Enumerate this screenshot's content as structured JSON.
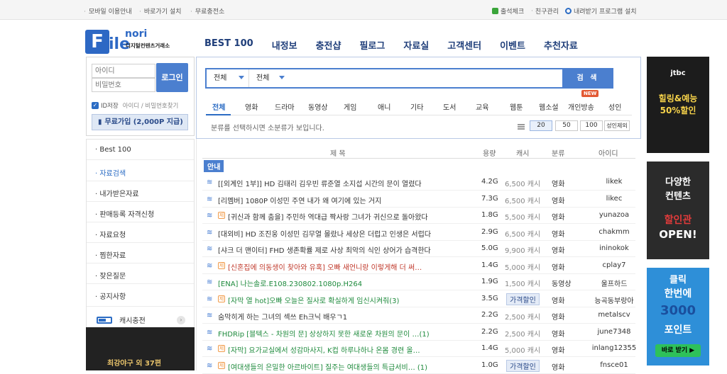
{
  "topbar": {
    "left": [
      "모바일 이용안내",
      "바로가기 설치",
      "무료충전소"
    ],
    "right": [
      "출석체크",
      "친구관리",
      "내려받기 프로그램 설치"
    ]
  },
  "logo": {
    "big": "F",
    "ile": "ile",
    "nori": "nori",
    "sub": "디지털컨텐츠거래소"
  },
  "gnb": [
    "BEST 100",
    "내정보",
    "충전샵",
    "필로그",
    "자료실",
    "고객센터",
    "이벤트",
    "추천자료"
  ],
  "login": {
    "id_placeholder": "아이디",
    "pw_placeholder": "비밀번호",
    "button": "로그인",
    "save_id": "ID저장",
    "find": "아이디 / 비밀번호찾기",
    "join": "무료가입 (2,000P 지급)"
  },
  "left_menu": [
    "Best 100",
    "자료검색",
    "내가받은자료",
    "판매등록 자격신청",
    "자료요청",
    "찜한자료",
    "잦은질문",
    "공지사항"
  ],
  "cash_label": "캐시충전",
  "left_banner_text": "최강야구 외 37편",
  "search": {
    "select1": "전체",
    "select2": "전체",
    "button": "검 색",
    "categories": [
      "전체",
      "영화",
      "드라마",
      "동영상",
      "게임",
      "애니",
      "기타",
      "도서",
      "교육",
      "웹툰",
      "웹소설",
      "개인방송",
      "성인"
    ],
    "new_badge": "NEW",
    "hint": "분류를 선택하시면 소분류가 보입니다.",
    "page_sizes": [
      "20",
      "50",
      "100"
    ],
    "adult_exclude": "성인제외"
  },
  "table": {
    "headers": {
      "title": "제 목",
      "size": "용량",
      "cash": "캐시",
      "kind": "분류",
      "id": "아이디"
    },
    "notice": "안내",
    "rows": [
      {
        "title": "[[외계인 1부]] HD 김태리 김우빈 류준열 소지섭 시간의 문이 열렸다",
        "size": "4.2G",
        "price": "6,500 캐시",
        "kind": "영화",
        "uid": "likek",
        "color": "#333333",
        "jj": false,
        "tag": false
      },
      {
        "title": "[리멤버] 1080P 이성민 주연 내가 왜 여기에 있는 거지",
        "size": "7.3G",
        "price": "6,500 캐시",
        "kind": "영화",
        "uid": "likec",
        "color": "#333333",
        "jj": false,
        "tag": false
      },
      {
        "title": "[귀신과 함께 춤을] 주민하 역대급 짝사랑 그녀가 귀신으로 돌아왔다",
        "size": "1.8G",
        "price": "5,500 캐시",
        "kind": "영화",
        "uid": "yunazoa",
        "color": "#333333",
        "jj": true,
        "tag": false
      },
      {
        "title": "[대외비] HD 조진웅 이성민 김무열 몰랐나 세상은 더럽고 인생은 서럽다",
        "size": "2.9G",
        "price": "6,500 캐시",
        "kind": "영화",
        "uid": "chakmm",
        "color": "#333333",
        "jj": false,
        "tag": false
      },
      {
        "title": "[샤크 더 맨이터] FHD 생존확률 제로 사상 최악의 식인 상어가 습격한다",
        "size": "5.0G",
        "price": "9,900 캐시",
        "kind": "영화",
        "uid": "ininokok",
        "color": "#333333",
        "jj": false,
        "tag": false
      },
      {
        "title": "[신혼집에 의동생이 찾아와 유혹] 오빠 새언니랑 이렇게해 더 써…",
        "size": "1.4G",
        "price": "5,000 캐시",
        "kind": "영화",
        "uid": "cplay7",
        "color": "#c0392b",
        "jj": true,
        "tag": false
      },
      {
        "title": "[ENA] 나는솔로.E108.230802.1080p.H264",
        "size": "1.9G",
        "price": "1,500 캐시",
        "kind": "동영상",
        "uid": "울프하드",
        "color": "#1e8a3c",
        "jj": false,
        "tag": false
      },
      {
        "title": "[자막 열 hot]오빠 오늘은 질사로 확실하게 임신시켜줘(3)",
        "size": "3.5G",
        "price": "가격할인",
        "kind": "영화",
        "uid": "능곡동부랑아",
        "color": "#1e8a3c",
        "jj": true,
        "tag": true
      },
      {
        "title": "숨막히게 하는 그녀의 섹쓰 Eh크닉 배우ㄱ1",
        "size": "2.2G",
        "price": "2,500 캐시",
        "kind": "영화",
        "uid": "metalscv",
        "color": "#333333",
        "jj": false,
        "tag": false
      },
      {
        "title": "FHDRip [블텍스 - 차원의 문] 상상하지 못한 새로운 차원의 문이 …(1)",
        "size": "2.2G",
        "price": "2,500 캐시",
        "kind": "영화",
        "uid": "june7348",
        "color": "#1e8a3c",
        "jj": false,
        "tag": false
      },
      {
        "title": "[자막] 요가교실에서 성감마사지, K컵 하루나하나 온몸 경련 올…",
        "size": "1.4G",
        "price": "5,000 캐시",
        "kind": "영화",
        "uid": "inlang12355",
        "color": "#1e8a3c",
        "jj": true,
        "tag": false
      },
      {
        "title": "[여대생들의 은밀한 아르바이트] 질주는 여대생들의 특급서비… (1)",
        "size": "1.0G",
        "price": "가격할인",
        "kind": "영화",
        "uid": "fnsce01",
        "color": "#1e8a3c",
        "jj": true,
        "tag": true
      }
    ]
  },
  "right_banners": [
    {
      "small": "jtbc",
      "big1": "힐링&예능",
      "big2": "50%할인"
    },
    {
      "small": "다양한",
      "big1": "컨텐츠",
      "big2": "할인관",
      "big3": "OPEN!"
    },
    {
      "small": "클릭",
      "big1": "한번에",
      "big2": "3000",
      "big3": "포인트",
      "btn": "바로 받기 ▶"
    }
  ],
  "colors": {
    "brand": "#2d68c4",
    "accent": "#4b7fcf",
    "navy": "#1f3e7a"
  }
}
